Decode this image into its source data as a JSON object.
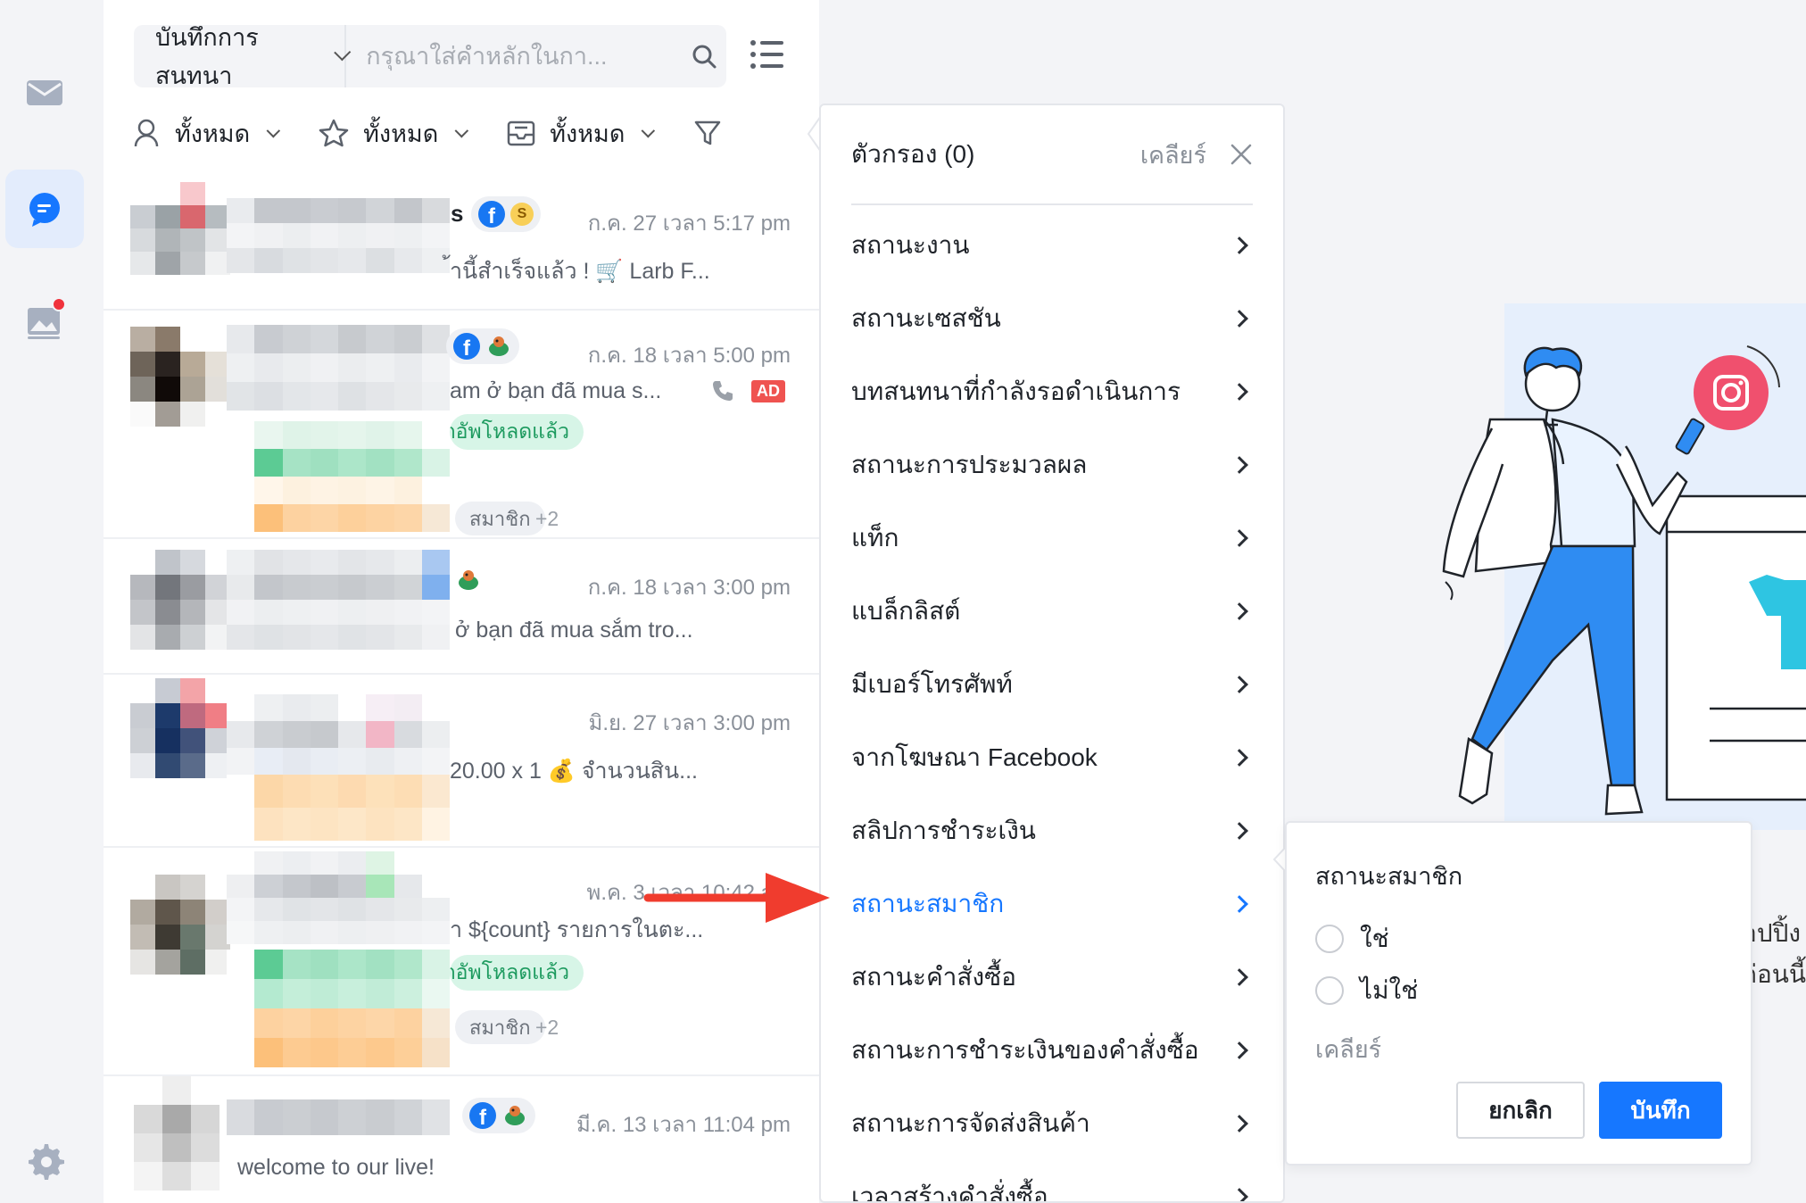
{
  "search": {
    "scope_label": "บันทึกการสนทนา",
    "placeholder": "กรุณาใส่คำหลักในกา..."
  },
  "filters": {
    "assignee": "ทั้งหมด",
    "starred": "ทั้งหมด",
    "inbox": "ทั้งหมด"
  },
  "conversations": [
    {
      "time": "ก.ค. 27 เวลา 5:17 pm",
      "message": "้านี้สำเร็จแล้ว ! 🛒 Larb F...",
      "name_suffix": "s"
    },
    {
      "time": "ก.ค. 18 เวลา 5:00 pm",
      "message": "am ở bạn đã mua s...",
      "ad_badge": "AD",
      "tag_green": "ข้อมูลถูกอัพโหลดแล้ว",
      "tag_gray": "สมาชิก",
      "more_tags": "+2"
    },
    {
      "time": "ก.ค. 18 เวลา 3:00 pm",
      "message": "ở bạn đã mua sắm tro..."
    },
    {
      "time": "มิ.ย. 27 เวลา 3:00 pm",
      "message": "20.00 x 1 💰 จำนวนสิน..."
    },
    {
      "time": "พ.ค. 3 เวลา 10:42 am",
      "message": "า ${count} รายการในตะ...",
      "tag_green": "ข้อมูลถูกอัพโหลดแล้ว",
      "tag_gray": "สมาชิก",
      "more_tags": "+2"
    },
    {
      "time": "มี.ค. 13 เวลา 11:04 pm",
      "message": "welcome to our live!"
    }
  ],
  "filter_panel": {
    "title": "ตัวกรอง (0)",
    "clear": "เคลียร์",
    "items": [
      "สถานะงาน",
      "สถานะเซสชัน",
      "บทสนทนาที่กำลังรอดำเนินการ",
      "สถานะการประมวลผล",
      "แท็ก",
      "แบล็กลิสต์",
      "มีเบอร์โทรศัพท์",
      "จากโฆษณา Facebook",
      "สลิปการชำระเงิน",
      "สถานะสมาชิก",
      "สถานะคำสั่งซื้อ",
      "สถานะการชำระเงินของคำสั่งซื้อ",
      "สถานะการจัดส่งสินค้า",
      "เวลาสร้างคำสั่งซื้อ"
    ],
    "active_index": 9
  },
  "member_popover": {
    "title": "สถานะสมาชิก",
    "options": [
      "ใช่",
      "ไม่ใช่"
    ],
    "clear": "เคลียร์",
    "cancel": "ยกเลิก",
    "save": "บันทึก"
  },
  "side_text": [
    "อปปิ้ง",
    "ก่อนนี้"
  ],
  "colors": {
    "accent": "#1677ff",
    "instagram": "#f0506e",
    "illustration_blue": "#2f8cf2"
  }
}
